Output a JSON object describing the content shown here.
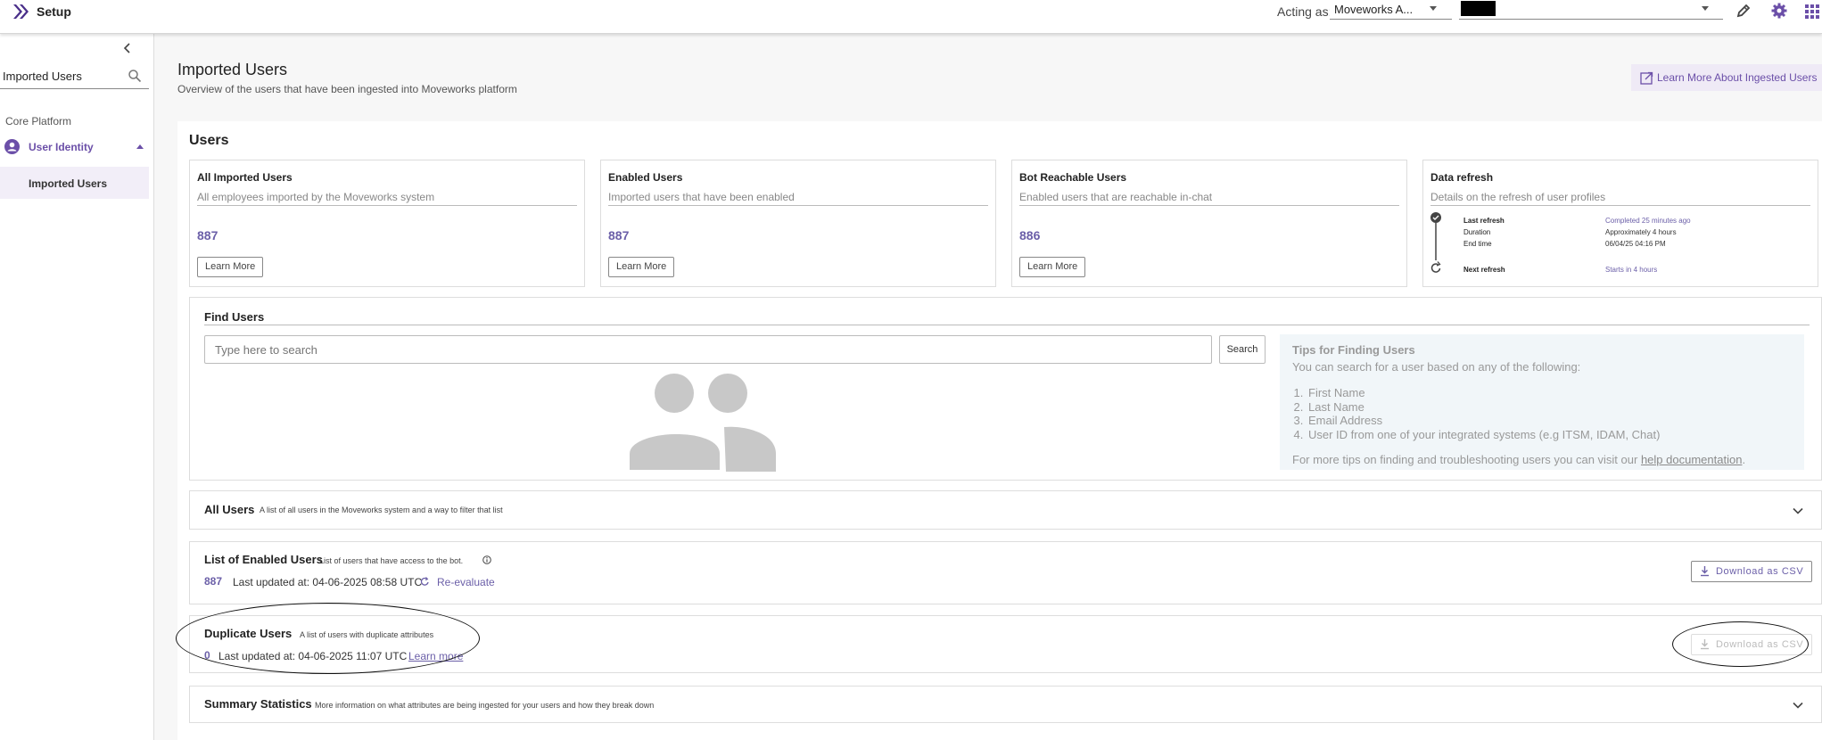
{
  "topbar": {
    "app_title": "Setup",
    "acting_as_label": "Acting as:",
    "acting_as_value": "Moveworks A...",
    "icons": [
      "edit-icon",
      "gear-icon",
      "apps-grid-icon"
    ]
  },
  "sidebar": {
    "search_value": "Imported Users",
    "section_label": "Core Platform",
    "group_label": "User Identity",
    "active_item": "Imported Users"
  },
  "header": {
    "title": "Imported Users",
    "subtitle": "Overview of the users that have been ingested into Moveworks platform",
    "learn_more_label": "Learn More About Ingested Users"
  },
  "users": {
    "heading": "Users",
    "cards": [
      {
        "title": "All Imported Users",
        "desc": "All employees imported by the Moveworks system",
        "value": "887",
        "button": "Learn More"
      },
      {
        "title": "Enabled Users",
        "desc": "Imported users that have been enabled",
        "value": "887",
        "button": "Learn More"
      },
      {
        "title": "Bot Reachable Users",
        "desc": "Enabled users that are reachable in-chat",
        "value": "886",
        "button": "Learn More"
      }
    ],
    "refresh": {
      "title": "Data refresh",
      "desc": "Details on the refresh of user profiles",
      "last_label": "Last refresh",
      "last_value": "Completed 25 minutes ago",
      "duration_label": "Duration",
      "duration_value": "Approximately 4 hours",
      "end_label": "End time",
      "end_value": "06/04/25 04:16 PM",
      "next_label": "Next refresh",
      "next_value": "Starts in 4 hours"
    }
  },
  "find": {
    "heading": "Find Users",
    "placeholder": "Type here to search",
    "search_label": "Search",
    "tips_title": "Tips for Finding Users",
    "tips_intro": "You can search for a user based on any of the following:",
    "tips_items": [
      "First Name",
      "Last Name",
      "Email Address",
      "User ID from one of your integrated systems (e.g ITSM, IDAM, Chat)"
    ],
    "tips_more": "For more tips on finding and troubleshooting users you can visit our",
    "tips_link": "help documentation",
    "tips_end": "."
  },
  "all_users": {
    "title": "All Users",
    "desc": "A list of all users in the Moveworks system and a way to filter that list"
  },
  "enabled_list": {
    "title": "List of Enabled Users",
    "desc": "List of users that have access to the bot.",
    "count": "887",
    "updated": "Last updated at: 04-06-2025 08:58 UTC",
    "reevaluate": "Re-evaluate",
    "download": "Download as CSV"
  },
  "duplicates": {
    "title": "Duplicate Users",
    "desc": "A list of users with duplicate attributes",
    "count": "0",
    "updated": "Last updated at: 04-06-2025 11:07 UTC",
    "learn_more": "Learn more",
    "download": "Download as CSV"
  },
  "summary": {
    "title": "Summary Statistics",
    "desc": "More information on what attributes are being ingested for your users and how they break down"
  },
  "colors": {
    "accent": "#6b4fa8",
    "value_purple": "#6b5fa8",
    "page_bg": "#f7f7f7",
    "tips_bg": "#f1f6f9"
  }
}
